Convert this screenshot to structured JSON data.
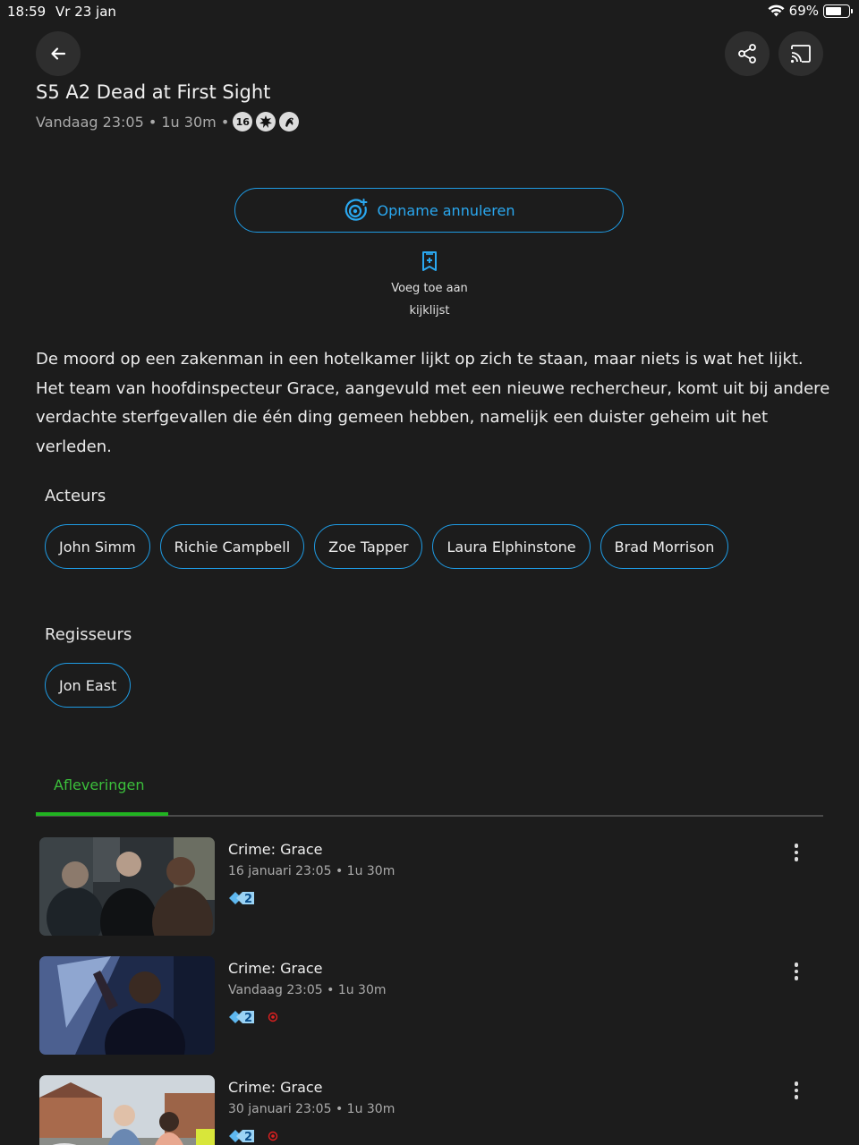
{
  "status_bar": {
    "time": "18:59",
    "date": "Vr 23 jan",
    "battery": "69%",
    "battery_level": 0.69
  },
  "header": {
    "back_icon": "arrow-left-icon",
    "share_icon": "share-icon",
    "cast_icon": "cast-icon"
  },
  "program": {
    "title": "S5 A2 Dead at First Sight",
    "meta": "Vandaag 23:05 • 1u 30m •",
    "ratings": [
      "16",
      "violence-icon",
      "fear-icon"
    ]
  },
  "actions": {
    "record_label": "Opname annuleren",
    "watchlist_line1": "Voeg toe aan",
    "watchlist_line2": "kijklijst"
  },
  "description": "De moord op een zakenman in een hotelkamer lijkt op zich te staan, maar niets is wat het lijkt. Het team van hoofdinspecteur Grace, aangevuld met een nieuwe rechercheur, komt uit bij andere verdachte sterfgevallen die één ding gemeen hebben, namelijk een duister geheim uit het verleden.",
  "cast": {
    "title": "Acteurs",
    "actors": [
      "John Simm",
      "Richie Campbell",
      "Zoe Tapper",
      "Laura Elphinstone",
      "Brad Morrison"
    ]
  },
  "directors": {
    "title": "Regisseurs",
    "names": [
      "Jon East"
    ]
  },
  "tabs": {
    "episodes_label": "Afleveringen"
  },
  "episodes": [
    {
      "title": "Crime: Grace",
      "meta": "16 januari 23:05 • 1u 30m",
      "channel_icon": "channel-2-icon",
      "recording": false
    },
    {
      "title": "Crime: Grace",
      "meta": "Vandaag 23:05 • 1u 30m",
      "channel_icon": "channel-2-icon",
      "recording": true
    },
    {
      "title": "Crime: Grace",
      "meta": "30 januari 23:05 • 1u 30m",
      "channel_icon": "channel-2-icon",
      "recording": true
    }
  ],
  "colors": {
    "accent_blue": "#1e9be4",
    "accent_green": "#21b421",
    "background": "#1c1c1c",
    "record_red": "#e02020"
  }
}
